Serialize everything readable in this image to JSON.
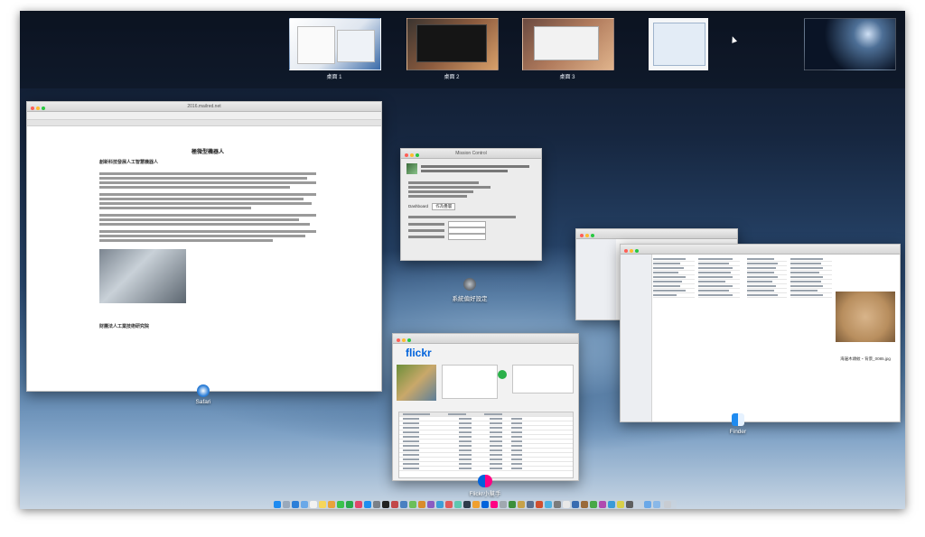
{
  "spaces": {
    "items": [
      {
        "label": "桌面 1"
      },
      {
        "label": "桌面 2"
      },
      {
        "label": "桌面 3"
      },
      {
        "label": ""
      },
      {
        "label": ""
      }
    ]
  },
  "safari": {
    "window_title": "2016.mailred.net",
    "article_heading": "極微型機器人",
    "article_subheading": "創新科技發展人工智慧機器人",
    "article_footer": "財團法人工業技術研究院",
    "app_label": "Safari"
  },
  "system_prefs": {
    "window_title": "Mission Control",
    "dashboard_label": "Dashboard",
    "dashboard_value": "作為疊層",
    "app_label": "系統偏好設定"
  },
  "flickr": {
    "logo": "flickr",
    "app_label": "Flickr小幫手"
  },
  "finder": {
    "image_caption": "海邊木頭紋・背景_0085.jpg",
    "app_label": "Finder"
  },
  "colors": {
    "safari_accent": "#2d7fd8",
    "flickr_blue": "#0063dc",
    "flickr_pink": "#ff0084",
    "finder_blue": "#1f8bf0"
  }
}
